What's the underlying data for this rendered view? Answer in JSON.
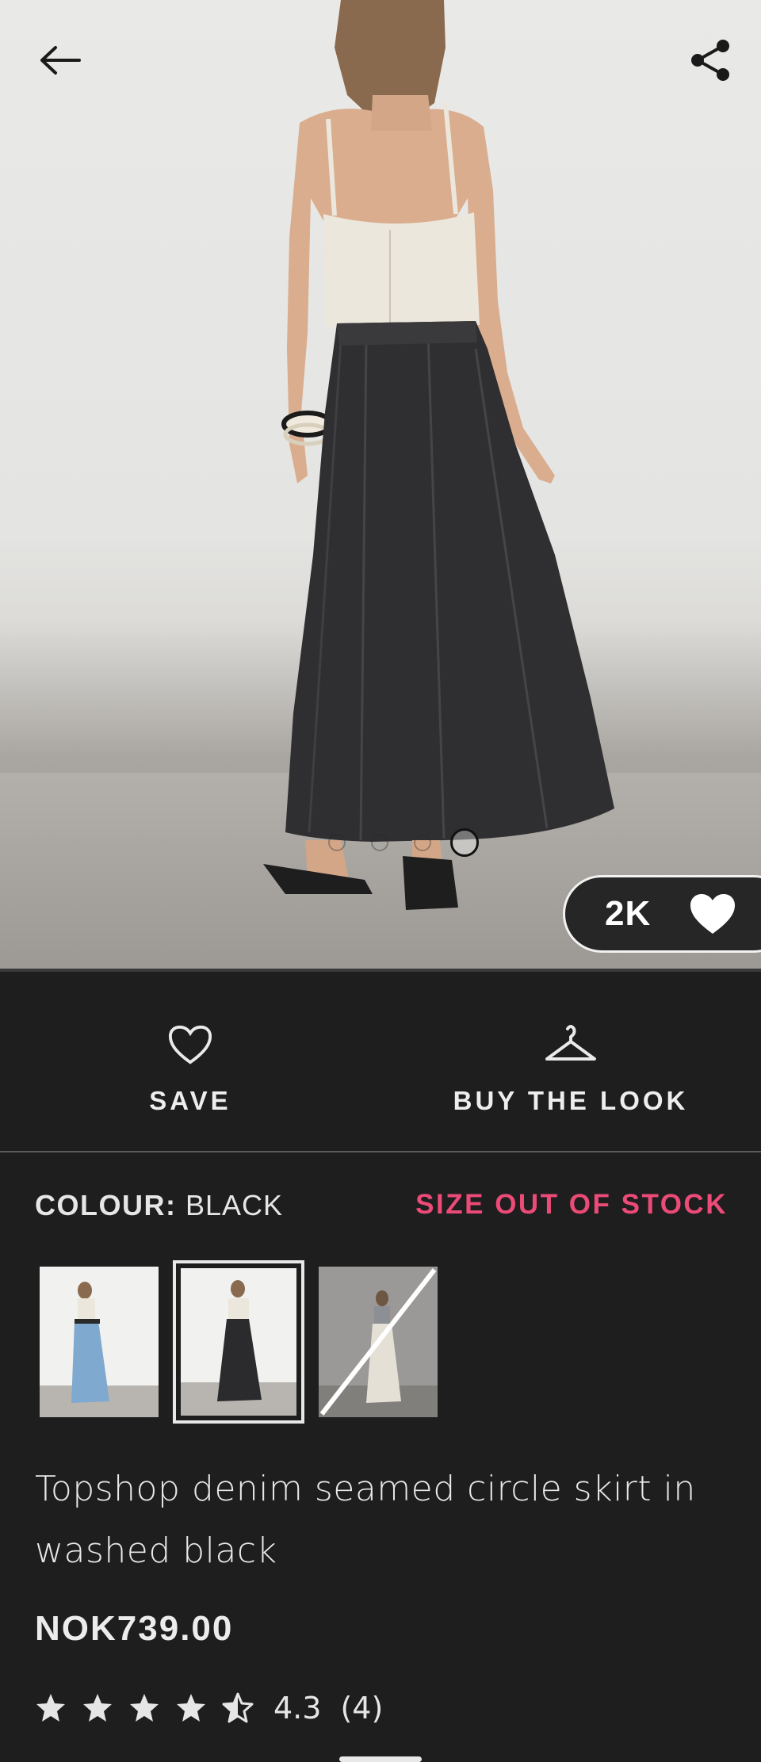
{
  "header": {
    "back_icon": "arrow-left-icon",
    "share_icon": "share-icon"
  },
  "gallery": {
    "image_count": 4,
    "active_index": 3
  },
  "likes": {
    "count": "2K",
    "icon": "heart-filled-icon"
  },
  "actions": {
    "save_label": "SAVE",
    "save_icon": "heart-outline-icon",
    "buy_look_label": "BUY THE LOOK",
    "buy_look_icon": "hanger-icon"
  },
  "colour": {
    "label": "COLOUR:",
    "value": "BLACK",
    "stock_status": "SIZE OUT OF STOCK",
    "stock_color": "#ec4a77",
    "swatches": [
      {
        "colour": "blue denim",
        "selected": false,
        "available": true
      },
      {
        "colour": "black",
        "selected": true,
        "available": true
      },
      {
        "colour": "ecru",
        "selected": false,
        "available": false
      }
    ]
  },
  "product": {
    "title": "Topshop denim seamed circle skirt in washed black",
    "price": "NOK739.00",
    "rating_value": "4.3",
    "rating_count": "(4)",
    "stars": 4.3
  }
}
